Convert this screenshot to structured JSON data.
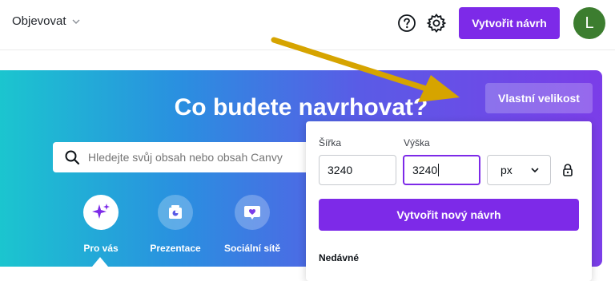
{
  "topbar": {
    "explore_label": "Objevovat",
    "create_button_label": "Vytvořit návrh",
    "avatar_letter": "L"
  },
  "hero": {
    "title": "Co budete navrhovat?",
    "custom_size_label": "Vlastní velikost",
    "search_placeholder": "Hledejte svůj obsah nebo obsah Canvy",
    "categories": [
      {
        "label": "Pro vás",
        "icon": "sparkle-icon"
      },
      {
        "label": "Prezentace",
        "icon": "presentation-icon"
      },
      {
        "label": "Sociální sítě",
        "icon": "heart-chat-icon"
      }
    ]
  },
  "popover": {
    "width_label": "Šířka",
    "height_label": "Výška",
    "width_value": "3240",
    "height_value": "3240",
    "unit": "px",
    "create_new_label": "Vytvořit nový návrh",
    "recent_label": "Nedávné"
  },
  "colors": {
    "brand_purple": "#7d2ae8",
    "avatar_green": "#3c7d2f",
    "annotation_arrow": "#d6a400"
  }
}
